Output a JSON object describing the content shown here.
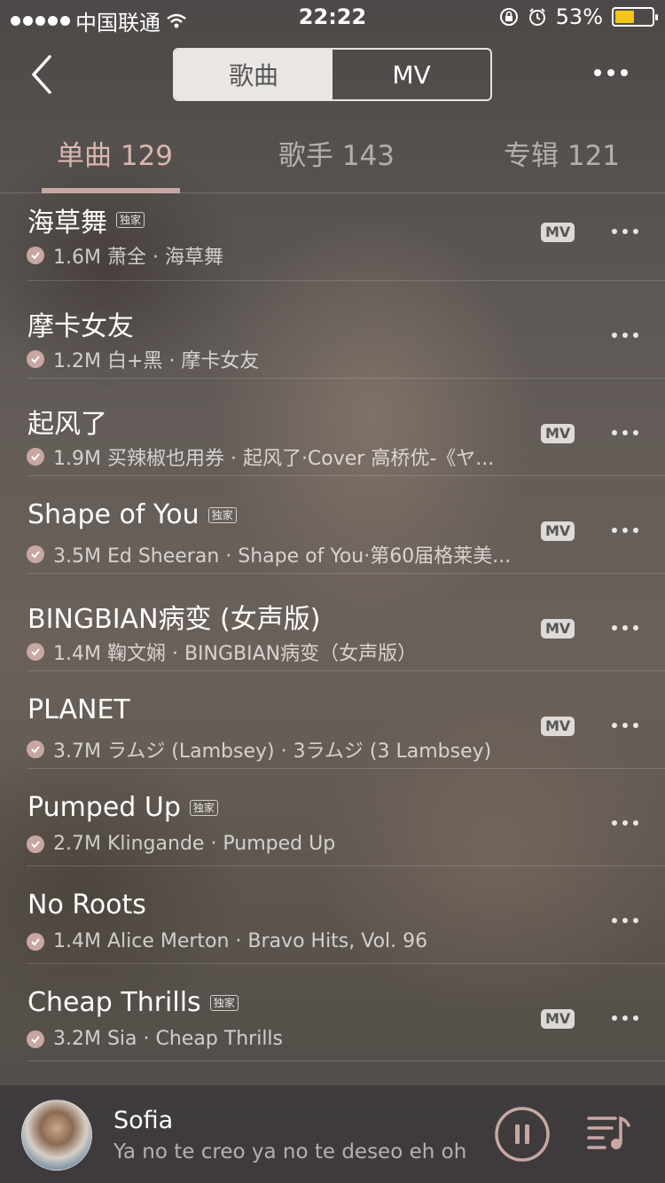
{
  "status_bar": {
    "carrier": "中国联通",
    "time": "22:22",
    "battery": "53%",
    "battery_level": 0.53
  },
  "nav": {
    "segments": [
      "歌曲",
      "MV"
    ],
    "active_segment": 0
  },
  "tabs": [
    {
      "label": "单曲 129"
    },
    {
      "label": "歌手 143"
    },
    {
      "label": "专辑 121"
    }
  ],
  "colors": {
    "accent": "#c8a7a2",
    "battery": "#f5c518"
  },
  "exclusive_label": "独家",
  "mv_label": "MV",
  "songs": [
    {
      "title": "海草舞",
      "exclusive": true,
      "sub": "1.6M 萧全 · 海草舞",
      "mv": true
    },
    {
      "title": "摩卡女友",
      "exclusive": false,
      "sub": "1.2M 白+黑 · 摩卡女友",
      "mv": false
    },
    {
      "title": "起风了",
      "exclusive": false,
      "sub": "1.9M 买辣椒也用券 · 起风了·Cover 高桥优-《ヤ...",
      "mv": true
    },
    {
      "title": "Shape of You",
      "exclusive": true,
      "sub": "3.5M Ed Sheeran · Shape of You·第60届格莱美...",
      "mv": true
    },
    {
      "title": "BINGBIAN病变 (女声版)",
      "exclusive": false,
      "sub": "1.4M 鞠文娴 · BINGBIAN病变（女声版）",
      "mv": true
    },
    {
      "title": "PLANET",
      "exclusive": false,
      "sub": "3.7M ラムジ (Lambsey) · 3ラムジ (3 Lambsey)",
      "mv": true
    },
    {
      "title": "Pumped Up",
      "exclusive": true,
      "sub": "2.7M Klingande · Pumped Up",
      "mv": false
    },
    {
      "title": "No Roots",
      "exclusive": false,
      "sub": "1.4M Alice Merton · Bravo Hits, Vol. 96",
      "mv": false
    },
    {
      "title": "Cheap Thrills",
      "exclusive": true,
      "sub": "3.2M Sia · Cheap Thrills",
      "mv": true
    },
    {
      "title": "",
      "exclusive": false,
      "sub": "",
      "mv": false
    }
  ],
  "player": {
    "title": "Sofia",
    "lyric": "Ya no te creo ya no te deseo eh oh"
  }
}
